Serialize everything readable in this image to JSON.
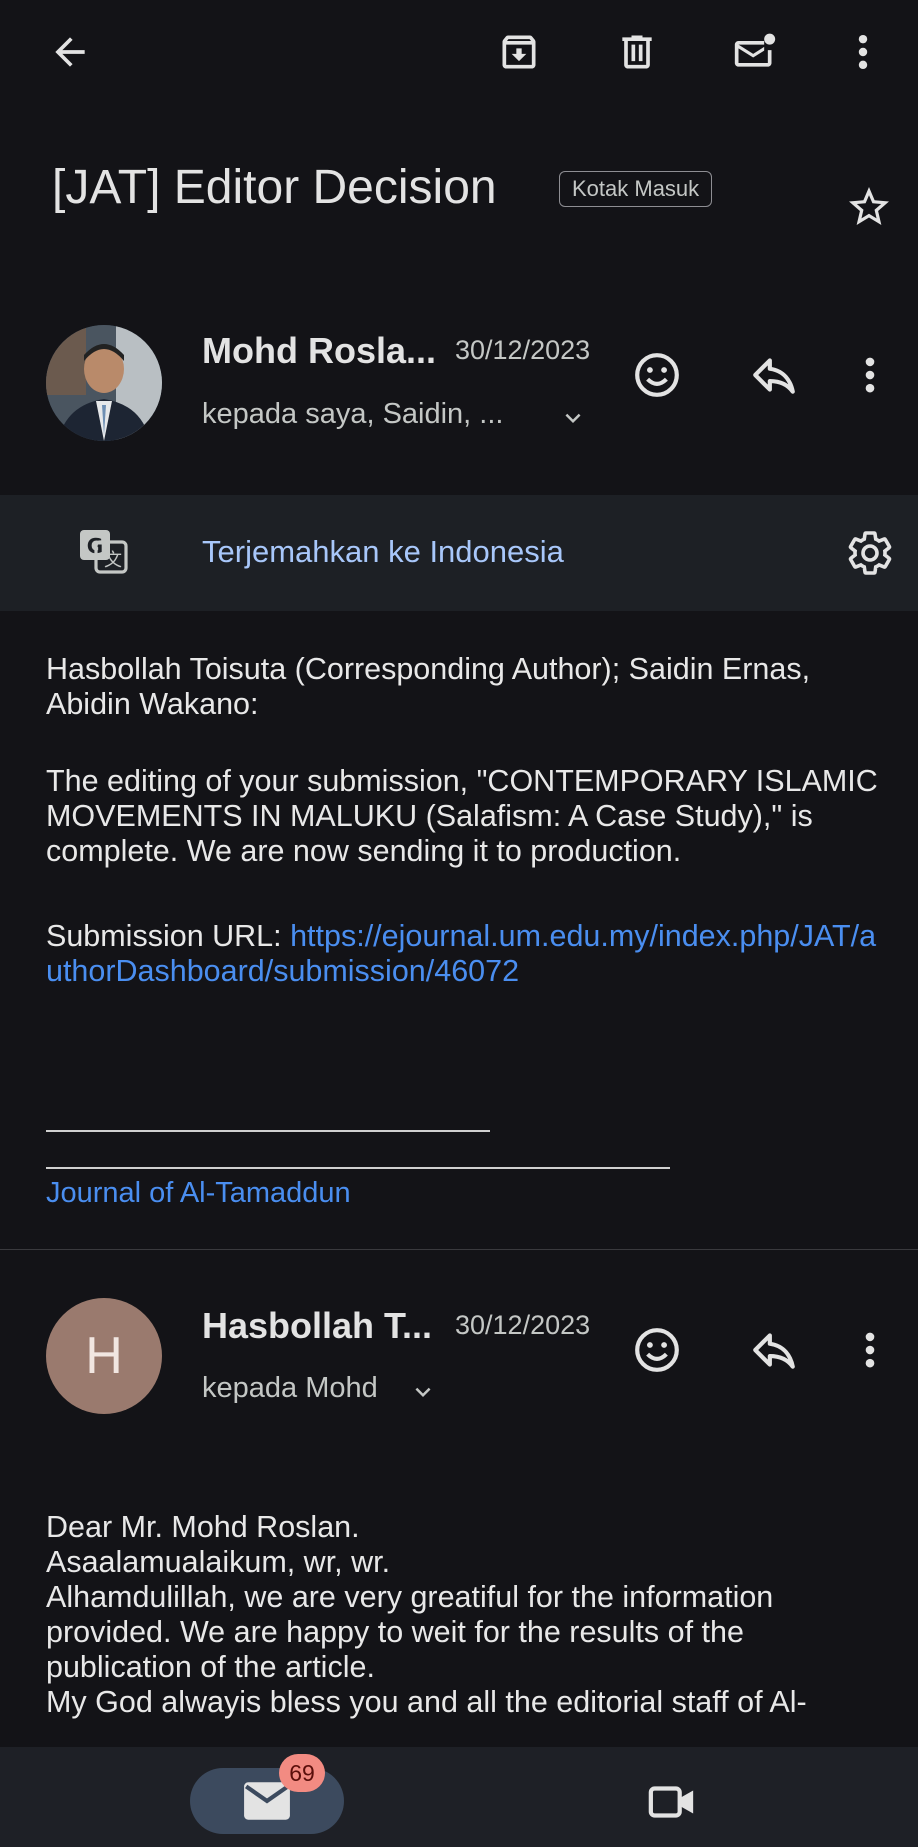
{
  "thread": {
    "subject": "[JAT] Editor Decision",
    "label": "Kotak Masuk"
  },
  "message1": {
    "sender": "Mohd Rosla...",
    "date": "30/12/2023",
    "recipients": "kepada saya, Saidin, ...",
    "translate_label": "Terjemahkan ke Indonesia",
    "body_p1": "Hasbollah Toisuta (Corresponding Author); Saidin Ernas, Abidin Wakano:",
    "body_p2": "The editing of your submission, \"CONTEMPORARY ISLAMIC MOVEMENTS IN MALUKU (Salafism: A Case Study),\" is complete. We are now sending it to production.",
    "submission_label": "Submission URL: ",
    "submission_url": "https://ejournal.um.edu.my/index.php/JAT/authorDashboard/submission/46072",
    "signature": "Journal of Al-Tamaddun"
  },
  "message2": {
    "avatar_letter": "H",
    "sender": "Hasbollah T...",
    "date": "30/12/2023",
    "recipients": "kepada Mohd",
    "lines": [
      "Dear Mr. Mohd Roslan.",
      "Asaalamualaikum, wr, wr.",
      "Alhamdulillah, we are very greatiful for the information provided. We are happy to weit for the results of the publication of the article.",
      "My God alwayis bless you and all the editorial staff of Al-"
    ]
  },
  "bottom_nav": {
    "mail_badge": "69"
  },
  "colors": {
    "background": "#131317",
    "link": "#4a8ef0",
    "translate_link": "#a8c7fa",
    "badge": "#f28b82"
  }
}
